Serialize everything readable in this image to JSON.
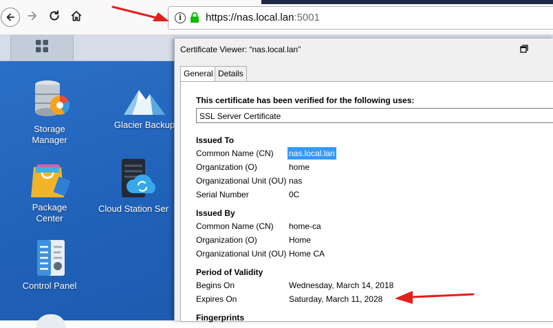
{
  "browser": {
    "url_host": "https://nas.local.lan",
    "url_port": ":5001",
    "icons": [
      "back-icon",
      "forward-icon",
      "reload-icon",
      "home-icon",
      "info-icon",
      "lock-icon"
    ]
  },
  "desktop": {
    "icons": [
      {
        "label_line1": "Storage",
        "label_line2": "Manager"
      },
      {
        "label_line1": "Glacier Backup"
      },
      {
        "label_line1": "Package",
        "label_line2": "Center"
      },
      {
        "label_line1": "Cloud Station Ser"
      },
      {
        "label_line1": "Control Panel"
      }
    ]
  },
  "dialog": {
    "title": "Certificate Viewer: “nas.local.lan”",
    "tabs": [
      "General",
      "Details"
    ],
    "verified_heading": "This certificate has been verified for the following uses:",
    "uses": "SSL Server Certificate",
    "issued_to": {
      "heading": "Issued To",
      "rows": [
        {
          "k": "Common Name (CN)",
          "v": "nas.local.lan"
        },
        {
          "k": "Organization (O)",
          "v": "home"
        },
        {
          "k": "Organizational Unit (OU)",
          "v": "nas"
        },
        {
          "k": "Serial Number",
          "v": "0C"
        }
      ]
    },
    "issued_by": {
      "heading": "Issued By",
      "rows": [
        {
          "k": "Common Name (CN)",
          "v": "home-ca"
        },
        {
          "k": "Organization (O)",
          "v": "Home"
        },
        {
          "k": "Organizational Unit (OU)",
          "v": "Home CA"
        }
      ]
    },
    "validity": {
      "heading": "Period of Validity",
      "rows": [
        {
          "k": "Begins On",
          "v": "Wednesday, March 14, 2018"
        },
        {
          "k": "Expires On",
          "v": "Saturday, March 11, 2028"
        }
      ]
    },
    "fingerprints_heading": "Fingerprints"
  },
  "colors": {
    "annotation_arrow": "#e0201b",
    "selection": "#3399ff",
    "desktop": "#2465bd"
  }
}
